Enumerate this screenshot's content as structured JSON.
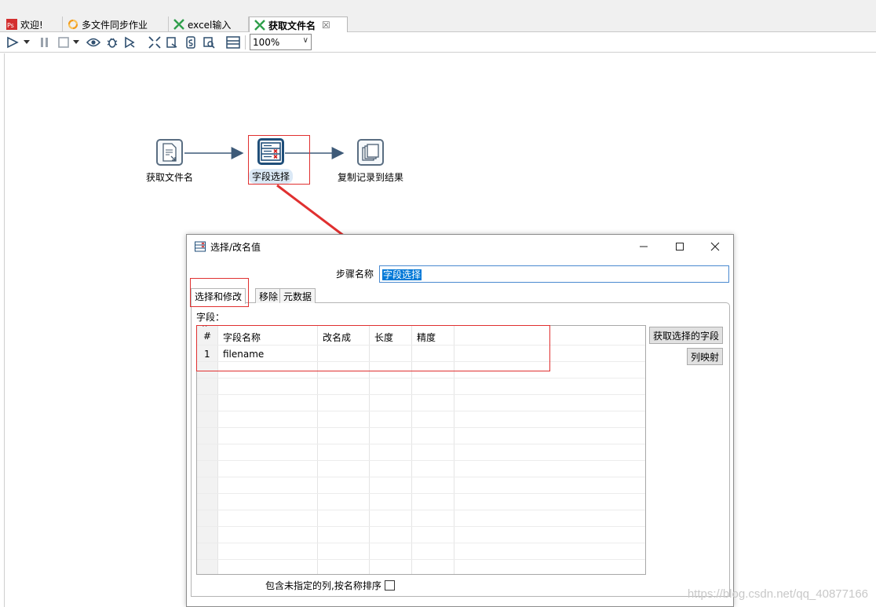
{
  "tabs": [
    {
      "label": "欢迎!",
      "icon": "pdi-logo-icon"
    },
    {
      "label": "多文件同步作业",
      "icon": "job-icon"
    },
    {
      "label": "excel输入",
      "icon": "transformation-icon"
    },
    {
      "label": "获取文件名",
      "icon": "transformation-icon",
      "close": "☒"
    }
  ],
  "toolbar": {
    "zoom": "100%"
  },
  "canvas": {
    "nodes": [
      {
        "label": "获取文件名",
        "icon": "get-filenames-icon"
      },
      {
        "label": "字段选择",
        "icon": "select-values-icon"
      },
      {
        "label": "复制记录到结果",
        "icon": "copy-rows-to-result-icon"
      }
    ]
  },
  "dialog": {
    "title": "选择/改名值",
    "step_name_label": "步骤名称",
    "step_name_value": "字段选择",
    "tabs": [
      "选择和修改",
      "移除",
      "元数据"
    ],
    "fields_label": "字段：",
    "columns": [
      "#",
      "字段名称",
      "改名成",
      "长度",
      "精度"
    ],
    "rows": [
      {
        "num": "1",
        "field": "filename",
        "rename": "",
        "length": "",
        "precision": ""
      }
    ],
    "get_fields_button": "获取选择的字段",
    "mapping_button": "列映射",
    "include_unspecified_label": "包含未指定的列,按名称排序"
  },
  "watermark": "https://blog.csdn.net/qq_40877166",
  "colors": {
    "accent": "#0078d7",
    "annotation": "#e03030",
    "node_border": "#1f4e79",
    "hop": "#3d5a78"
  }
}
